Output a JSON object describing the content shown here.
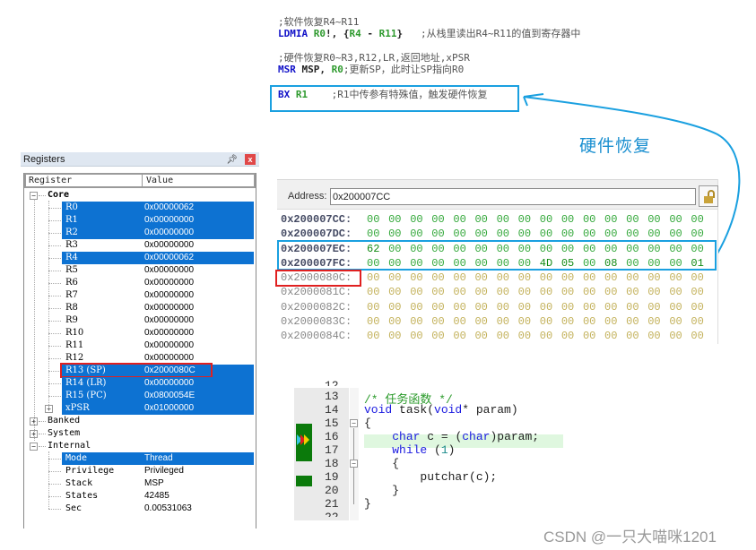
{
  "annotation": {
    "asm_lines": [
      {
        "comment": ";软件恢复R4~R11"
      },
      {
        "op": "LDMIA",
        "args": [
          {
            "t": "reg",
            "v": "R0"
          },
          {
            "t": "plain",
            "v": "!, {"
          },
          {
            "t": "reg",
            "v": "R4"
          },
          {
            "t": "plain",
            "v": " - "
          },
          {
            "t": "reg",
            "v": "R11"
          },
          {
            "t": "plain",
            "v": "}"
          }
        ],
        "comment": "   ;从栈里读出R4~R11的值到寄存器中"
      },
      {
        "comment": ";硬件恢复R0~R3,R12,LR,返回地址,xPSR"
      },
      {
        "op": "MSR",
        "args": [
          {
            "t": "plain",
            "v": "MSP, "
          },
          {
            "t": "reg",
            "v": "R0"
          }
        ],
        "comment": ";更新SP，此时让SP指向R0"
      },
      {
        "op": "BX",
        "args": [
          {
            "t": "reg",
            "v": "R1"
          }
        ],
        "comment": "    ;R1中传参有特殊值，触发硬件恢复"
      }
    ],
    "hw_label": "硬件恢复",
    "accent_color": "#1aa0e0",
    "highlight_red": "#e02020"
  },
  "registers": {
    "title": "Registers",
    "pin_icon": "pin-icon",
    "close_label": "x",
    "columns": [
      "Register",
      "Value"
    ],
    "groups": [
      {
        "name": "Core",
        "expanded": true,
        "items": [
          {
            "name": "R0",
            "value": "0x00000062",
            "selected": true
          },
          {
            "name": "R1",
            "value": "0x00000000",
            "selected": true
          },
          {
            "name": "R2",
            "value": "0x00000000",
            "selected": true
          },
          {
            "name": "R3",
            "value": "0x00000000",
            "selected": false
          },
          {
            "name": "R4",
            "value": "0x00000062",
            "selected": true
          },
          {
            "name": "R5",
            "value": "0x00000000",
            "selected": false
          },
          {
            "name": "R6",
            "value": "0x00000000",
            "selected": false
          },
          {
            "name": "R7",
            "value": "0x00000000",
            "selected": false
          },
          {
            "name": "R8",
            "value": "0x00000000",
            "selected": false
          },
          {
            "name": "R9",
            "value": "0x00000000",
            "selected": false
          },
          {
            "name": "R10",
            "value": "0x00000000",
            "selected": false
          },
          {
            "name": "R11",
            "value": "0x00000000",
            "selected": false
          },
          {
            "name": "R12",
            "value": "0x00000000",
            "selected": false
          },
          {
            "name": "R13 (SP)",
            "value": "0x2000080C",
            "selected": true,
            "boxed": true
          },
          {
            "name": "R14 (LR)",
            "value": "0x00000000",
            "selected": true
          },
          {
            "name": "R15 (PC)",
            "value": "0x0800054E",
            "selected": true
          },
          {
            "name": "xPSR",
            "value": "0x01000000",
            "selected": true,
            "expandable": true
          }
        ]
      },
      {
        "name": "Banked",
        "expanded": false,
        "items": []
      },
      {
        "name": "System",
        "expanded": false,
        "items": []
      },
      {
        "name": "Internal",
        "expanded": true,
        "items": [
          {
            "name": "Mode",
            "value": "Thread",
            "selected": true
          },
          {
            "name": "Privilege",
            "value": "Privileged",
            "selected": false
          },
          {
            "name": "Stack",
            "value": "MSP",
            "selected": false
          },
          {
            "name": "States",
            "value": "42485",
            "selected": false
          },
          {
            "name": "Sec",
            "value": "0.00531063",
            "selected": false
          }
        ]
      }
    ]
  },
  "memory": {
    "address_label": "Address:",
    "address_value": "0x200007CC",
    "lock_icon": "unlock-icon",
    "rows": [
      {
        "addr": "0x200007CC:",
        "bytes": [
          "00",
          "00",
          "00",
          "00",
          "00",
          "00",
          "00",
          "00",
          "00",
          "00",
          "00",
          "00",
          "00",
          "00",
          "00",
          "00"
        ],
        "highlight": true
      },
      {
        "addr": "0x200007DC:",
        "bytes": [
          "00",
          "00",
          "00",
          "00",
          "00",
          "00",
          "00",
          "00",
          "00",
          "00",
          "00",
          "00",
          "00",
          "00",
          "00",
          "00"
        ],
        "highlight": true
      },
      {
        "addr": "0x200007EC:",
        "bytes": [
          "62",
          "00",
          "00",
          "00",
          "00",
          "00",
          "00",
          "00",
          "00",
          "00",
          "00",
          "00",
          "00",
          "00",
          "00",
          "00"
        ],
        "highlight": true
      },
      {
        "addr": "0x200007FC:",
        "bytes": [
          "00",
          "00",
          "00",
          "00",
          "00",
          "00",
          "00",
          "00",
          "4D",
          "05",
          "00",
          "08",
          "00",
          "00",
          "00",
          "01"
        ],
        "highlight": true
      },
      {
        "addr": "0x2000080C:",
        "bytes": [
          "00",
          "00",
          "00",
          "00",
          "00",
          "00",
          "00",
          "00",
          "00",
          "00",
          "00",
          "00",
          "00",
          "00",
          "00",
          "00"
        ],
        "highlight": false
      },
      {
        "addr": "0x2000081C:",
        "bytes": [
          "00",
          "00",
          "00",
          "00",
          "00",
          "00",
          "00",
          "00",
          "00",
          "00",
          "00",
          "00",
          "00",
          "00",
          "00",
          "00"
        ],
        "highlight": false
      },
      {
        "addr": "0x2000082C:",
        "bytes": [
          "00",
          "00",
          "00",
          "00",
          "00",
          "00",
          "00",
          "00",
          "00",
          "00",
          "00",
          "00",
          "00",
          "00",
          "00",
          "00"
        ],
        "highlight": false
      },
      {
        "addr": "0x2000083C:",
        "bytes": [
          "00",
          "00",
          "00",
          "00",
          "00",
          "00",
          "00",
          "00",
          "00",
          "00",
          "00",
          "00",
          "00",
          "00",
          "00",
          "00"
        ],
        "highlight": false
      },
      {
        "addr": "0x2000084C:",
        "bytes": [
          "00",
          "00",
          "00",
          "00",
          "00",
          "00",
          "00",
          "00",
          "00",
          "00",
          "00",
          "00",
          "00",
          "00",
          "00",
          "00"
        ],
        "highlight": false
      }
    ]
  },
  "code": {
    "lines": [
      {
        "no": "13",
        "segs": [
          {
            "t": "c-comment",
            "v": "/* 任务函数 */"
          }
        ]
      },
      {
        "no": "14",
        "segs": [
          {
            "t": "c-kw",
            "v": "void"
          },
          {
            "t": "",
            "v": " task("
          },
          {
            "t": "c-kw",
            "v": "void"
          },
          {
            "t": "",
            "v": "* param)"
          }
        ]
      },
      {
        "no": "15",
        "segs": [
          {
            "t": "",
            "v": "{"
          }
        ],
        "fold": "minus"
      },
      {
        "no": "16",
        "segs": [
          {
            "t": "",
            "v": "    "
          },
          {
            "t": "c-kw",
            "v": "char"
          },
          {
            "t": "",
            "v": " c = ("
          },
          {
            "t": "c-kw",
            "v": "char"
          },
          {
            "t": "",
            "v": ")param;"
          }
        ],
        "current": true
      },
      {
        "no": "17",
        "segs": [
          {
            "t": "",
            "v": "    "
          },
          {
            "t": "c-kw",
            "v": "while"
          },
          {
            "t": "",
            "v": " ("
          },
          {
            "t": "c-num",
            "v": "1"
          },
          {
            "t": "",
            "v": ")"
          }
        ]
      },
      {
        "no": "18",
        "segs": [
          {
            "t": "",
            "v": "    {"
          }
        ],
        "fold": "minus"
      },
      {
        "no": "19",
        "segs": [
          {
            "t": "",
            "v": "        putchar(c);"
          }
        ]
      },
      {
        "no": "20",
        "segs": [
          {
            "t": "",
            "v": "    }"
          }
        ]
      },
      {
        "no": "21",
        "segs": [
          {
            "t": "",
            "v": "}"
          }
        ]
      }
    ]
  },
  "watermark": "CSDN @一只大喵咪1201"
}
